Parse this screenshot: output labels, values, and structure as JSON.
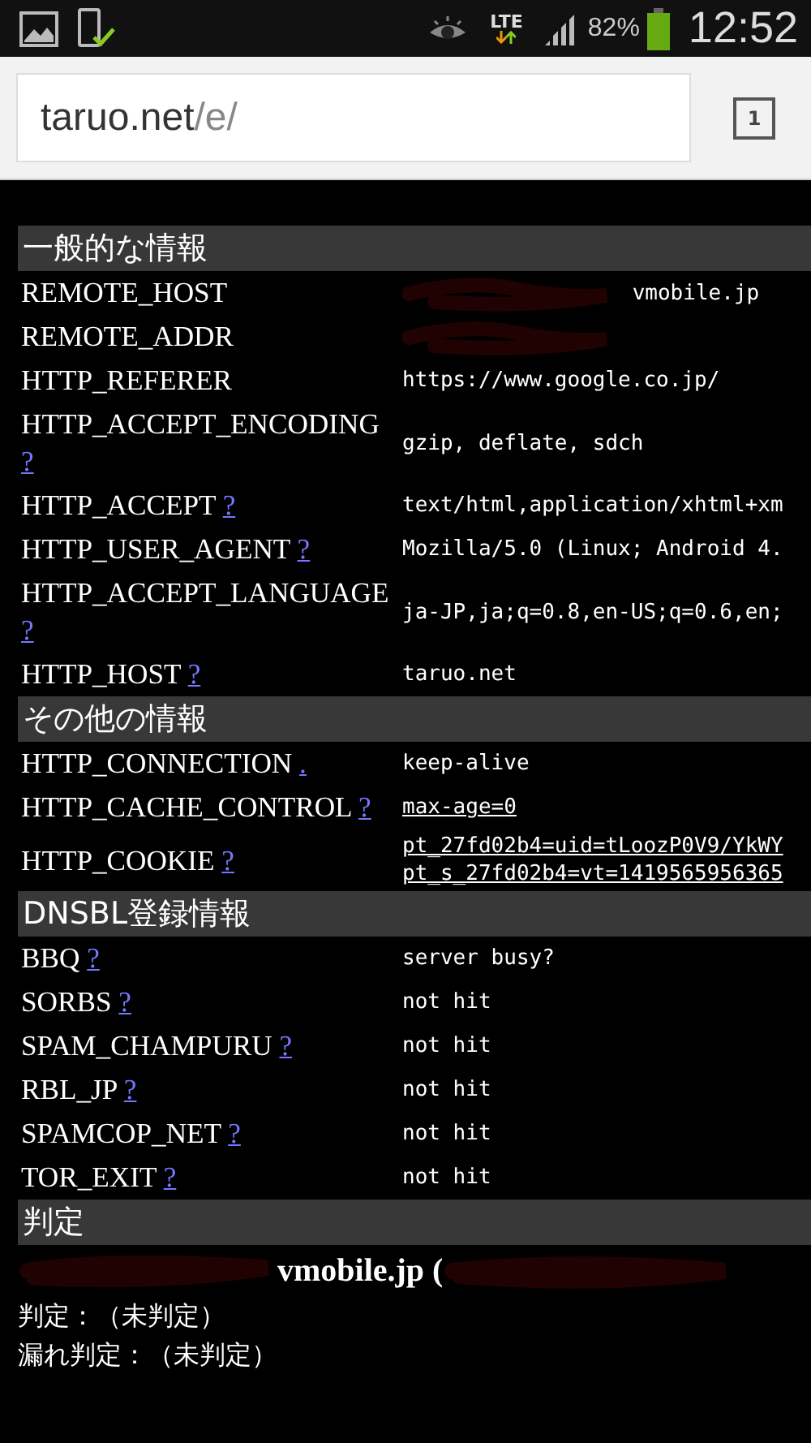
{
  "status_bar": {
    "network": "LTE",
    "battery": "82%",
    "time": "12:52"
  },
  "address_bar": {
    "host": "taruo.net",
    "path": "/e/",
    "tab_count": "1"
  },
  "sections": [
    {
      "title": "一般的な情報",
      "rows": [
        {
          "label": "REMOTE_HOST",
          "value": "vmobile.jp",
          "redacted": true
        },
        {
          "label": "REMOTE_ADDR",
          "redacted": true
        },
        {
          "label": "HTTP_REFERER",
          "value": "https://www.google.co.jp/"
        },
        {
          "label": "HTTP_ACCEPT_ENCODING",
          "help": "?",
          "value": "gzip, deflate, sdch"
        },
        {
          "label": "HTTP_ACCEPT",
          "help": "?",
          "value": "text/html,application/xhtml+xm"
        },
        {
          "label": "HTTP_USER_AGENT",
          "help": "?",
          "value": "Mozilla/5.0 (Linux; Android 4."
        },
        {
          "label": "HTTP_ACCEPT_LANGUAGE",
          "help": "?",
          "value": "ja-JP,ja;q=0.8,en-US;q=0.6,en;"
        },
        {
          "label": "HTTP_HOST",
          "help": "?",
          "value": "taruo.net"
        }
      ]
    },
    {
      "title": "その他の情報",
      "rows": [
        {
          "label": "HTTP_CONNECTION",
          "help": ".",
          "value": "keep-alive"
        },
        {
          "label": "HTTP_CACHE_CONTROL",
          "help": "?",
          "value": "max-age=0",
          "link": true
        },
        {
          "label": "HTTP_COOKIE",
          "help": "?",
          "values": [
            "pt_27fd02b4=uid=tLoozP0V9/YkWY",
            "pt_s_27fd02b4=vt=1419565956365"
          ],
          "link": true
        }
      ]
    },
    {
      "title": "DNSBL登録情報",
      "rows": [
        {
          "label": "BBQ",
          "help": "?",
          "value": "server busy?"
        },
        {
          "label": "SORBS",
          "help": "?",
          "value": "not hit"
        },
        {
          "label": "SPAM_CHAMPURU",
          "help": "?",
          "value": "not hit"
        },
        {
          "label": "RBL_JP",
          "help": "?",
          "value": "not hit"
        },
        {
          "label": "SPAMCOP_NET",
          "help": "?",
          "value": "not hit"
        },
        {
          "label": "TOR_EXIT",
          "help": "?",
          "value": "not hit"
        }
      ]
    }
  ],
  "verdict": {
    "title": "判定",
    "host": "vmobile.jp (",
    "lines": [
      "判定：（未判定）",
      "漏れ判定：（未判定）"
    ]
  }
}
